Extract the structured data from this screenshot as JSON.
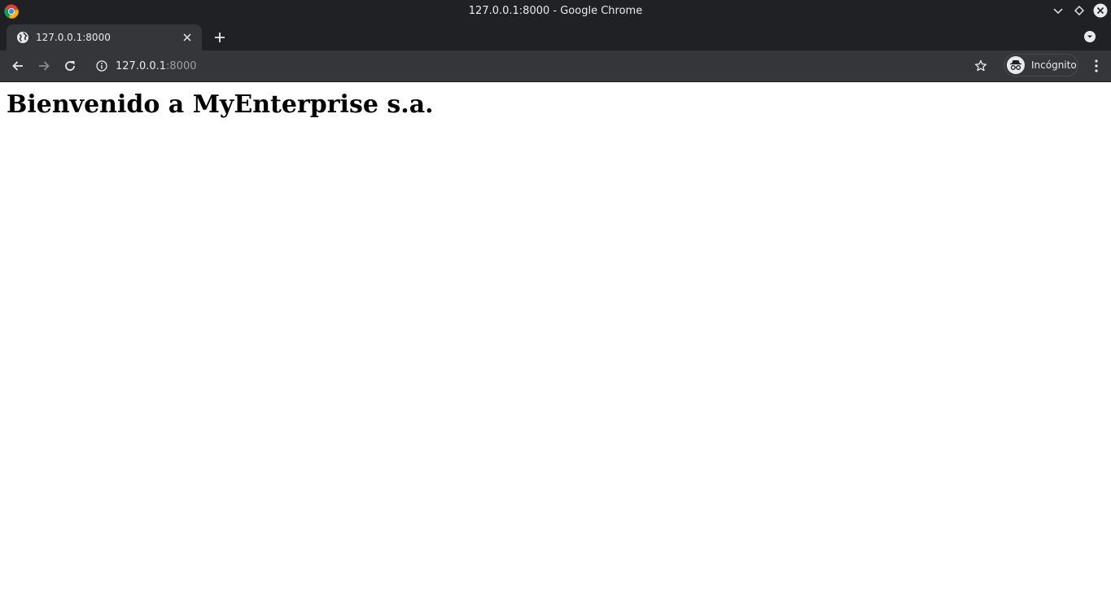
{
  "window": {
    "title": "127.0.0.1:8000 - Google Chrome",
    "app_icon": "chrome-icon"
  },
  "tabs": [
    {
      "title": "127.0.0.1:8000",
      "favicon": "globe-icon",
      "active": true
    }
  ],
  "toolbar": {
    "url_host": "127.0.0.1",
    "url_port": ":8000",
    "profile_label": "Incógnito"
  },
  "page": {
    "heading": "Bienvenido a MyEnterprise s.a."
  },
  "colors": {
    "titlebar_bg": "#202124",
    "toolbar_bg": "#35363a",
    "text_light": "#e8eaed",
    "text_dim": "#9aa0a6",
    "page_bg": "#ffffff"
  }
}
